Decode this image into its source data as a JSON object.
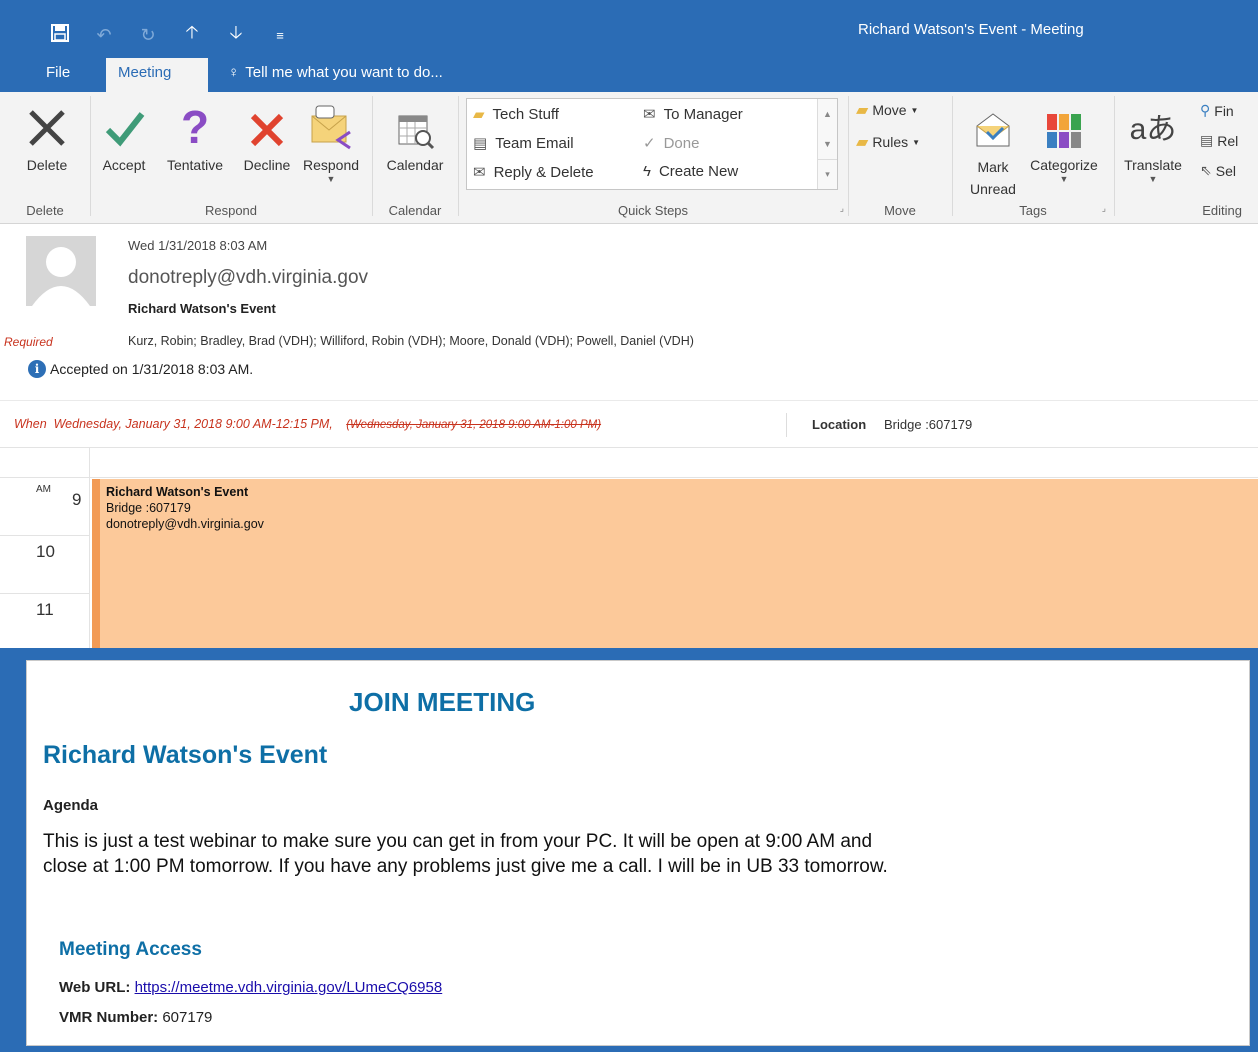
{
  "window": {
    "title": "Richard Watson's Event - Meeting",
    "qat": [
      "save-icon",
      "undo-icon",
      "redo-icon",
      "up-arrow-icon",
      "down-arrow-icon",
      "customize-icon"
    ]
  },
  "tabs": {
    "file": "File",
    "meeting": "Meeting",
    "tell_me": "Tell me what you want to do..."
  },
  "ribbon": {
    "delete_group": {
      "label": "Delete",
      "delete": "Delete"
    },
    "respond_group": {
      "label": "Respond",
      "accept": "Accept",
      "tentative": "Tentative",
      "decline": "Decline",
      "respond": "Respond"
    },
    "calendar_group": {
      "label": "Calendar",
      "calendar": "Calendar"
    },
    "quick_steps": {
      "label": "Quick Steps",
      "tech_stuff": "Tech Stuff",
      "to_manager": "To Manager",
      "team_email": "Team Email",
      "done": "Done",
      "reply_delete": "Reply & Delete",
      "create_new": "Create New"
    },
    "move_group": {
      "label": "Move",
      "move": "Move",
      "rules": "Rules"
    },
    "tags_group": {
      "label": "Tags",
      "mark_unread_1": "Mark",
      "mark_unread_2": "Unread",
      "categorize": "Categorize"
    },
    "editing_group": {
      "label": "Editing",
      "translate": "Translate",
      "find": "Fin",
      "related": "Rel",
      "select": "Sel"
    }
  },
  "message": {
    "date": "Wed 1/31/2018 8:03 AM",
    "from": "donotreply@vdh.virginia.gov",
    "subject": "Richard Watson's Event",
    "required_label": "Required",
    "attendees": "Kurz, Robin; Bradley, Brad (VDH); Williford, Robin (VDH); Moore, Donald (VDH); Powell, Daniel (VDH)",
    "accepted": "Accepted on 1/31/2018 8:03 AM."
  },
  "when": {
    "label": "When",
    "value": "Wednesday, January 31, 2018 9:00 AM-12:15 PM,",
    "previous": "(Wednesday, January 31, 2018 9:00 AM-1:00 PM)",
    "location_label": "Location",
    "location_value": "Bridge :607179"
  },
  "calendar": {
    "hours": [
      {
        "hour": "9",
        "suffix": "AM"
      },
      {
        "hour": "10",
        "suffix": ""
      },
      {
        "hour": "11",
        "suffix": ""
      }
    ],
    "appointment": {
      "title": "Richard Watson's Event",
      "location": "Bridge :607179",
      "organizer": "donotreply@vdh.virginia.gov"
    }
  },
  "body": {
    "join": "JOIN MEETING",
    "event_title": "Richard Watson's Event",
    "agenda_heading": "Agenda",
    "agenda_text": "This is just a test webinar to make sure you can get in from your PC. It will be open at 9:00 AM and close at 1:00 PM tomorrow. If you have any problems just give me a call. I will be in UB 33 tomorrow.",
    "access_heading": "Meeting Access",
    "web_url_label": "Web URL:",
    "web_url": "https://meetme.vdh.virginia.gov/LUmeCQ6958",
    "vmr_label": "VMR Number:",
    "vmr_value": "607179"
  },
  "colors": {
    "accent": "#2b6cb5",
    "appointment_fill": "#fcc99a",
    "appointment_bar": "#f29a55",
    "heading_blue": "#0e6fa6",
    "required_red": "#c8331e"
  }
}
